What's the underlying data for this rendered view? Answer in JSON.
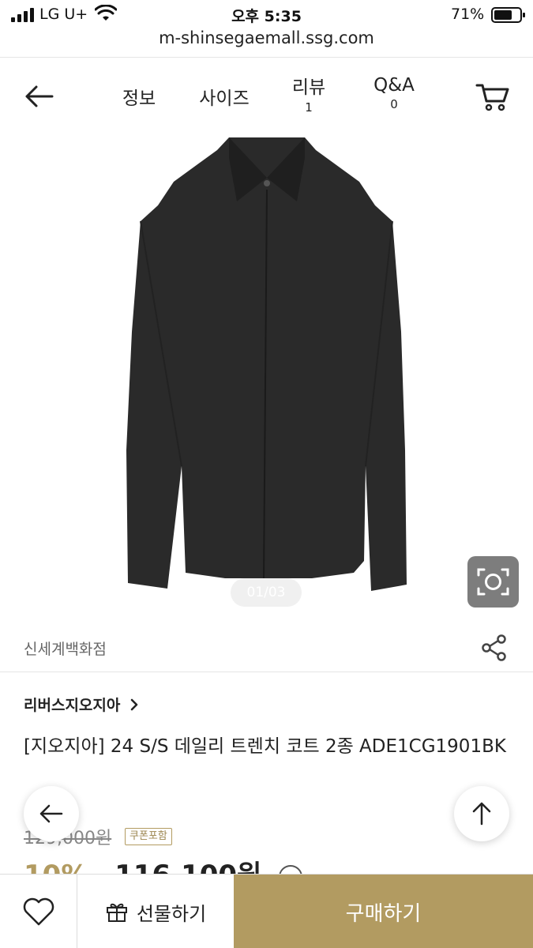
{
  "status_bar": {
    "carrier": "LG U+",
    "time": "오후 5:35",
    "battery_percent": "71%",
    "battery_level": 0.71
  },
  "browser": {
    "url": "m-shinsegaemall.ssg.com"
  },
  "nav": {
    "tabs": [
      {
        "label": "정보"
      },
      {
        "label": "사이즈"
      },
      {
        "label": "리뷰",
        "count": "1"
      },
      {
        "label": "Q&A",
        "count": "0"
      }
    ]
  },
  "gallery": {
    "pager": "01/03"
  },
  "store": {
    "name": "신세계백화점"
  },
  "product": {
    "brand": "리버스지오지아",
    "title": "[지오지아] 24 S/S 데일리 트렌치 코트 2종 ADE1CG1901BK",
    "original_price": "129,000원",
    "coupon_badge": "쿠폰포함",
    "discount": "10%",
    "price": "116,100원"
  },
  "bottom_bar": {
    "gift_label": "선물하기",
    "buy_label": "구매하기"
  },
  "colors": {
    "accent": "#b29b61",
    "lens_button": "#7d7d7d"
  }
}
